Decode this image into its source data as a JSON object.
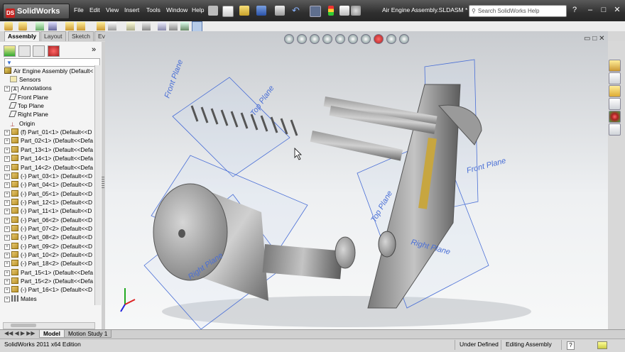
{
  "app": {
    "name": "SolidWorks",
    "document_title": "Air Engine Assembly.SLDASM *"
  },
  "menu": [
    "File",
    "Edit",
    "View",
    "Insert",
    "Tools",
    "Window",
    "Help"
  ],
  "search": {
    "placeholder": "Search SolidWorks Help"
  },
  "tabs": [
    {
      "label": "Assembly",
      "active": true
    },
    {
      "label": "Layout",
      "active": false
    },
    {
      "label": "Sketch",
      "active": false
    },
    {
      "label": "Evaluate",
      "active": false
    }
  ],
  "tree": {
    "root": "Air Engine Assembly  (Default<",
    "items": [
      {
        "label": "Sensors",
        "icon": "sensor-icon",
        "expandable": false
      },
      {
        "label": "Annotations",
        "icon": "annotation-icon",
        "expandable": true
      },
      {
        "label": "Front Plane",
        "icon": "plane-icon",
        "expandable": false
      },
      {
        "label": "Top Plane",
        "icon": "plane-icon",
        "expandable": false
      },
      {
        "label": "Right Plane",
        "icon": "plane-icon",
        "expandable": false
      },
      {
        "label": "Origin",
        "icon": "origin-icon",
        "expandable": false
      },
      {
        "label": "(f) Part_01<1> (Default<<D",
        "icon": "part-icon",
        "expandable": true
      },
      {
        "label": "Part_02<1> (Default<<Defa",
        "icon": "part-icon",
        "expandable": true
      },
      {
        "label": "Part_13<1> (Default<<Defa",
        "icon": "part-icon",
        "expandable": true
      },
      {
        "label": "Part_14<1> (Default<<Defa",
        "icon": "part-icon",
        "expandable": true
      },
      {
        "label": "Part_14<2> (Default<<Defa",
        "icon": "part-icon",
        "expandable": true
      },
      {
        "label": "(-) Part_03<1> (Default<<D",
        "icon": "part-icon",
        "expandable": true
      },
      {
        "label": "(-) Part_04<1> (Default<<D",
        "icon": "part-icon",
        "expandable": true
      },
      {
        "label": "(-) Part_05<1> (Default<<D",
        "icon": "part-icon",
        "expandable": true
      },
      {
        "label": "(-) Part_12<1> (Default<<D",
        "icon": "part-icon",
        "expandable": true
      },
      {
        "label": "(-) Part_11<1> (Default<<D",
        "icon": "part-icon",
        "expandable": true
      },
      {
        "label": "(-) Part_06<2> (Default<<D",
        "icon": "part-icon",
        "expandable": true
      },
      {
        "label": "(-) Part_07<2> (Default<<D",
        "icon": "part-icon",
        "expandable": true
      },
      {
        "label": "(-) Part_08<2> (Default<<D",
        "icon": "part-icon",
        "expandable": true
      },
      {
        "label": "(-) Part_09<2> (Default<<D",
        "icon": "part-icon",
        "expandable": true
      },
      {
        "label": "(-) Part_10<2> (Default<<D",
        "icon": "part-icon",
        "expandable": true
      },
      {
        "label": "(-) Part_18<2> (Default<<D",
        "icon": "part-icon",
        "expandable": true
      },
      {
        "label": "Part_15<1> (Default<<Defa",
        "icon": "part-icon",
        "expandable": true
      },
      {
        "label": "Part_15<2> (Default<<Defa",
        "icon": "part-icon",
        "expandable": true
      },
      {
        "label": "(-) Part_16<1> (Default<<D",
        "icon": "part-icon",
        "expandable": true
      },
      {
        "label": "Mates",
        "icon": "mates-icon",
        "expandable": true
      }
    ]
  },
  "viewport": {
    "plane_labels": [
      "Front Plane",
      "Top Plane",
      "Right Plane",
      "Front Plane",
      "Top Plane",
      "Right Plane"
    ]
  },
  "bottom_tabs": [
    {
      "label": "Model",
      "active": true
    },
    {
      "label": "Motion Study 1",
      "active": false
    }
  ],
  "status": {
    "edition": "SolidWorks 2011 x64 Edition",
    "state": "Under Defined",
    "mode": "Editing Assembly",
    "help": "?"
  },
  "colors": {
    "accent_red": "#c8221f",
    "part_gold": "#d4b04a",
    "plane_blue": "#4a6fd6"
  }
}
